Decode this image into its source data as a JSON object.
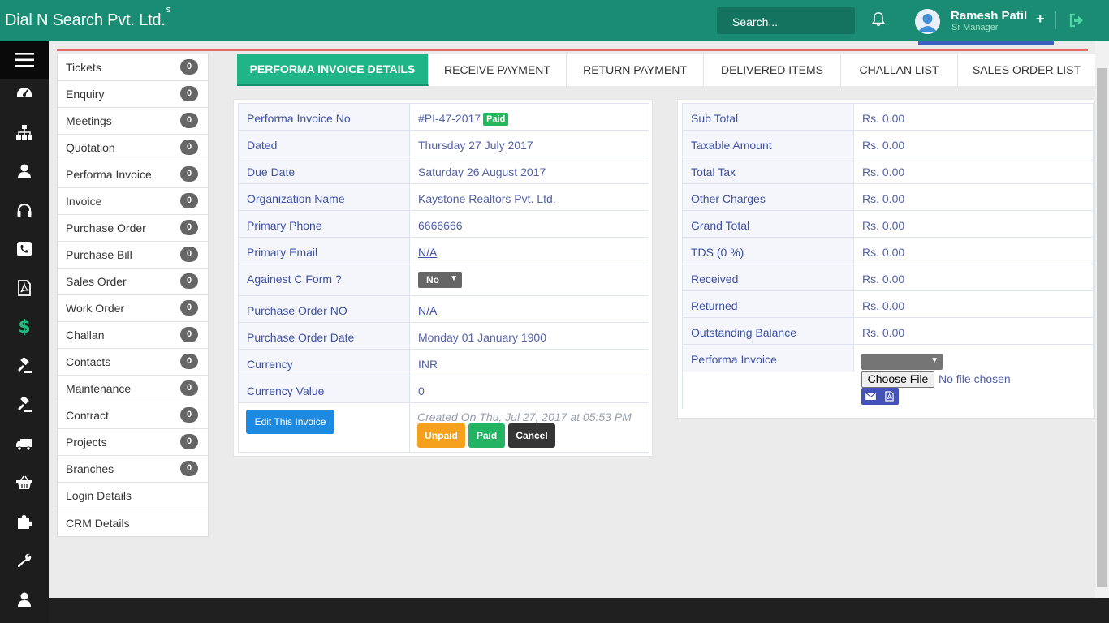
{
  "header": {
    "brand": "Dial N Search Pvt. Ltd.",
    "brand_sup": "s",
    "search_placeholder": "Search...",
    "user_name": "Ramesh Patil",
    "user_role": "Sr Manager",
    "add_label": "+"
  },
  "sidebar_icons": [
    "menu-icon",
    "dashboard-icon",
    "sitemap-icon",
    "user-icon",
    "headset-icon",
    "phone-icon",
    "pdf-icon",
    "dollar-icon",
    "gavel-icon",
    "gavel-icon-2",
    "truck-icon",
    "basket-icon",
    "puzzle-icon",
    "wrench-icon",
    "user-icon-2"
  ],
  "dollar_glyph": "$",
  "menu": {
    "items": [
      {
        "label": "Tickets",
        "count": "0"
      },
      {
        "label": "Enquiry",
        "count": "0"
      },
      {
        "label": "Meetings",
        "count": "0"
      },
      {
        "label": "Quotation",
        "count": "0"
      },
      {
        "label": "Performa Invoice",
        "count": "0"
      },
      {
        "label": "Invoice",
        "count": "0"
      },
      {
        "label": "Purchase Order",
        "count": "0"
      },
      {
        "label": "Purchase Bill",
        "count": "0"
      },
      {
        "label": "Sales Order",
        "count": "0"
      },
      {
        "label": "Work Order",
        "count": "0"
      },
      {
        "label": "Challan",
        "count": "0"
      },
      {
        "label": "Contacts",
        "count": "0"
      },
      {
        "label": "Maintenance",
        "count": "0"
      },
      {
        "label": "Contract",
        "count": "0"
      },
      {
        "label": "Projects",
        "count": "0"
      },
      {
        "label": "Branches",
        "count": "0"
      },
      {
        "label": "Login Details"
      },
      {
        "label": "CRM Details"
      }
    ]
  },
  "tabs": [
    {
      "label": "PERFORMA INVOICE DETAILS",
      "active": true
    },
    {
      "label": "RECEIVE PAYMENT"
    },
    {
      "label": "RETURN PAYMENT"
    },
    {
      "label": "DELIVERED ITEMS"
    },
    {
      "label": "CHALLAN LIST"
    },
    {
      "label": "SALES ORDER LIST"
    }
  ],
  "invoice": {
    "fields": [
      {
        "label": "Performa Invoice No",
        "value": "#PI-47-2017"
      },
      {
        "label": "Dated",
        "value": "Thursday 27 July 2017"
      },
      {
        "label": "Due Date",
        "value": "Saturday 26 August 2017"
      },
      {
        "label": "Organization Name",
        "value": "Kaystone Realtors Pvt. Ltd."
      },
      {
        "label": "Primary Phone",
        "value": "6666666"
      },
      {
        "label": "Primary Email",
        "value": "N/A"
      },
      {
        "label": "Againest C Form ?",
        "value": "No"
      },
      {
        "label": "Purchase Order NO",
        "value": "N/A"
      },
      {
        "label": "Purchase Order Date",
        "value": "Monday 01 January 1900"
      },
      {
        "label": "Currency",
        "value": "INR"
      },
      {
        "label": "Currency Value",
        "value": "0"
      }
    ],
    "status_badge": "Paid",
    "edit_button": "Edit This Invoice",
    "created_text": "Created On Thu, Jul 27, 2017 at 05:53 PM",
    "unpaid_button": "Unpaid",
    "paid_button": "Paid",
    "cancel_button": "Cancel"
  },
  "totals": {
    "fields": [
      {
        "label": "Sub Total",
        "value": "Rs. 0.00"
      },
      {
        "label": "Taxable Amount",
        "value": "Rs. 0.00"
      },
      {
        "label": "Total Tax",
        "value": "Rs. 0.00"
      },
      {
        "label": "Other Charges",
        "value": "Rs. 0.00"
      },
      {
        "label": "Grand Total",
        "value": "Rs. 0.00"
      },
      {
        "label": "TDS (0 %)",
        "value": "Rs. 0.00"
      },
      {
        "label": "Received",
        "value": "Rs. 0.00"
      },
      {
        "label": "Returned",
        "value": "Rs. 0.00"
      },
      {
        "label": "Outstanding Balance",
        "value": "Rs. 0.00"
      },
      {
        "label": "Performa Invoice",
        "value": ""
      }
    ],
    "choose_file": "Choose File",
    "no_file": "No file chosen"
  },
  "colors": {
    "topbar": "#1b8c74",
    "accent": "#1fb586",
    "label_text": "#3f51a5"
  }
}
